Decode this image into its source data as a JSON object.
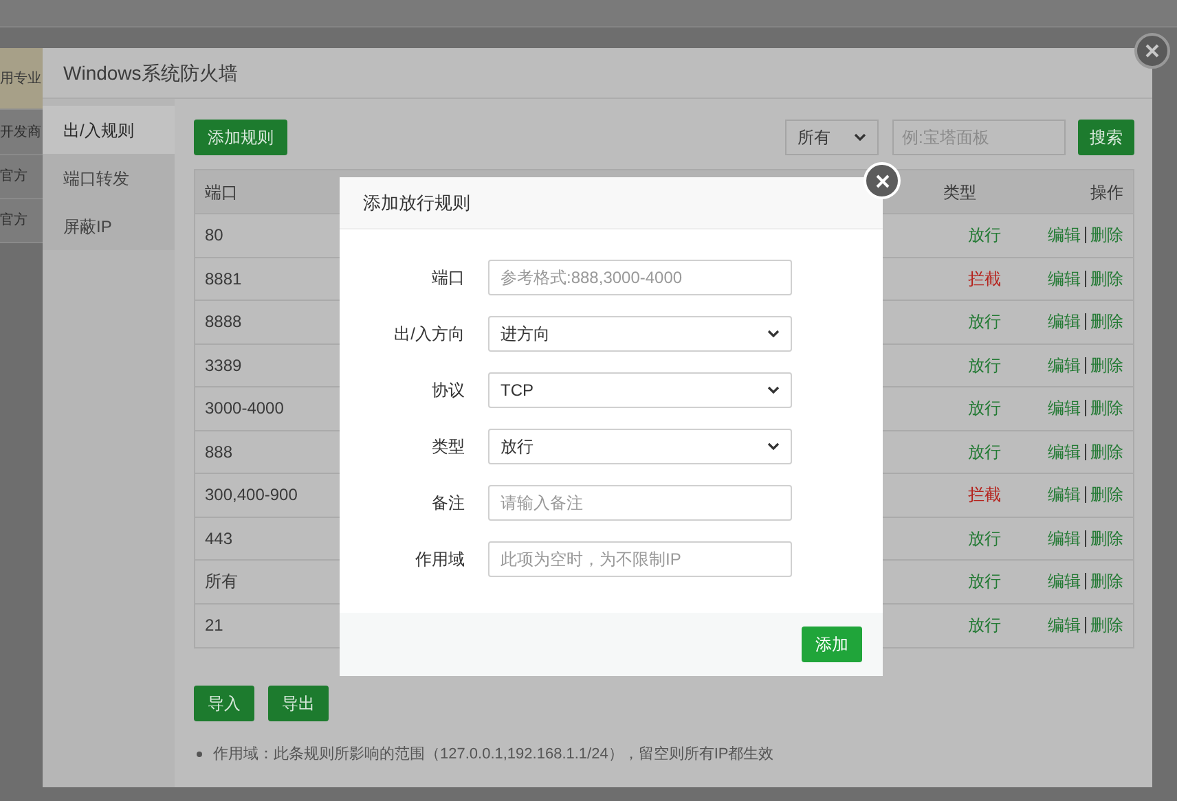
{
  "background_page": {
    "items": [
      "用专业",
      "开发商",
      "官方",
      "官方"
    ]
  },
  "firewall_dialog": {
    "title": "Windows系统防火墙",
    "sidebar": {
      "items": [
        {
          "label": "出/入规则",
          "selected": true
        },
        {
          "label": "端口转发",
          "selected": false
        },
        {
          "label": "屏蔽IP",
          "selected": false
        }
      ]
    },
    "add_rule_button": "添加规则",
    "filter_select": "所有",
    "search": {
      "placeholder": "例:宝塔面板"
    },
    "search_button": "搜索",
    "table": {
      "columns": [
        "端口",
        "类型",
        "操作"
      ],
      "rows": [
        {
          "port": "80",
          "type": "放行",
          "blocked": false,
          "edit": "编辑",
          "delete": "删除"
        },
        {
          "port": "8881",
          "type": "拦截",
          "blocked": true,
          "edit": "编辑",
          "delete": "删除"
        },
        {
          "port": "8888",
          "type": "放行",
          "blocked": false,
          "edit": "编辑",
          "delete": "删除"
        },
        {
          "port": "3389",
          "type": "放行",
          "blocked": false,
          "edit": "编辑",
          "delete": "删除"
        },
        {
          "port": "3000-4000",
          "type": "放行",
          "blocked": false,
          "edit": "编辑",
          "delete": "删除"
        },
        {
          "port": "888",
          "type": "放行",
          "blocked": false,
          "edit": "编辑",
          "delete": "删除"
        },
        {
          "port": "300,400-900",
          "type": "拦截",
          "blocked": true,
          "edit": "编辑",
          "delete": "删除"
        },
        {
          "port": "443",
          "type": "放行",
          "blocked": false,
          "edit": "编辑",
          "delete": "删除"
        },
        {
          "port": "所有",
          "type": "放行",
          "blocked": false,
          "edit": "编辑",
          "delete": "删除"
        },
        {
          "port": "21",
          "type": "放行",
          "blocked": false,
          "edit": "编辑",
          "delete": "删除"
        }
      ]
    },
    "import_button": "导入",
    "export_button": "导出",
    "note": "作用域：此条规则所影响的范围（127.0.0.1,192.168.1.1/24），留空则所有IP都生效"
  },
  "add_rule_dialog": {
    "title": "添加放行规则",
    "fields": [
      {
        "label": "端口",
        "kind": "input",
        "placeholder": "参考格式:888,3000-4000"
      },
      {
        "label": "出/入方向",
        "kind": "select",
        "value": "进方向"
      },
      {
        "label": "协议",
        "kind": "select",
        "value": "TCP"
      },
      {
        "label": "类型",
        "kind": "select",
        "value": "放行"
      },
      {
        "label": "备注",
        "kind": "input",
        "placeholder": "请输入备注"
      },
      {
        "label": "作用域",
        "kind": "input",
        "placeholder": "此项为空时，为不限制IP"
      }
    ],
    "submit_button": "添加"
  }
}
